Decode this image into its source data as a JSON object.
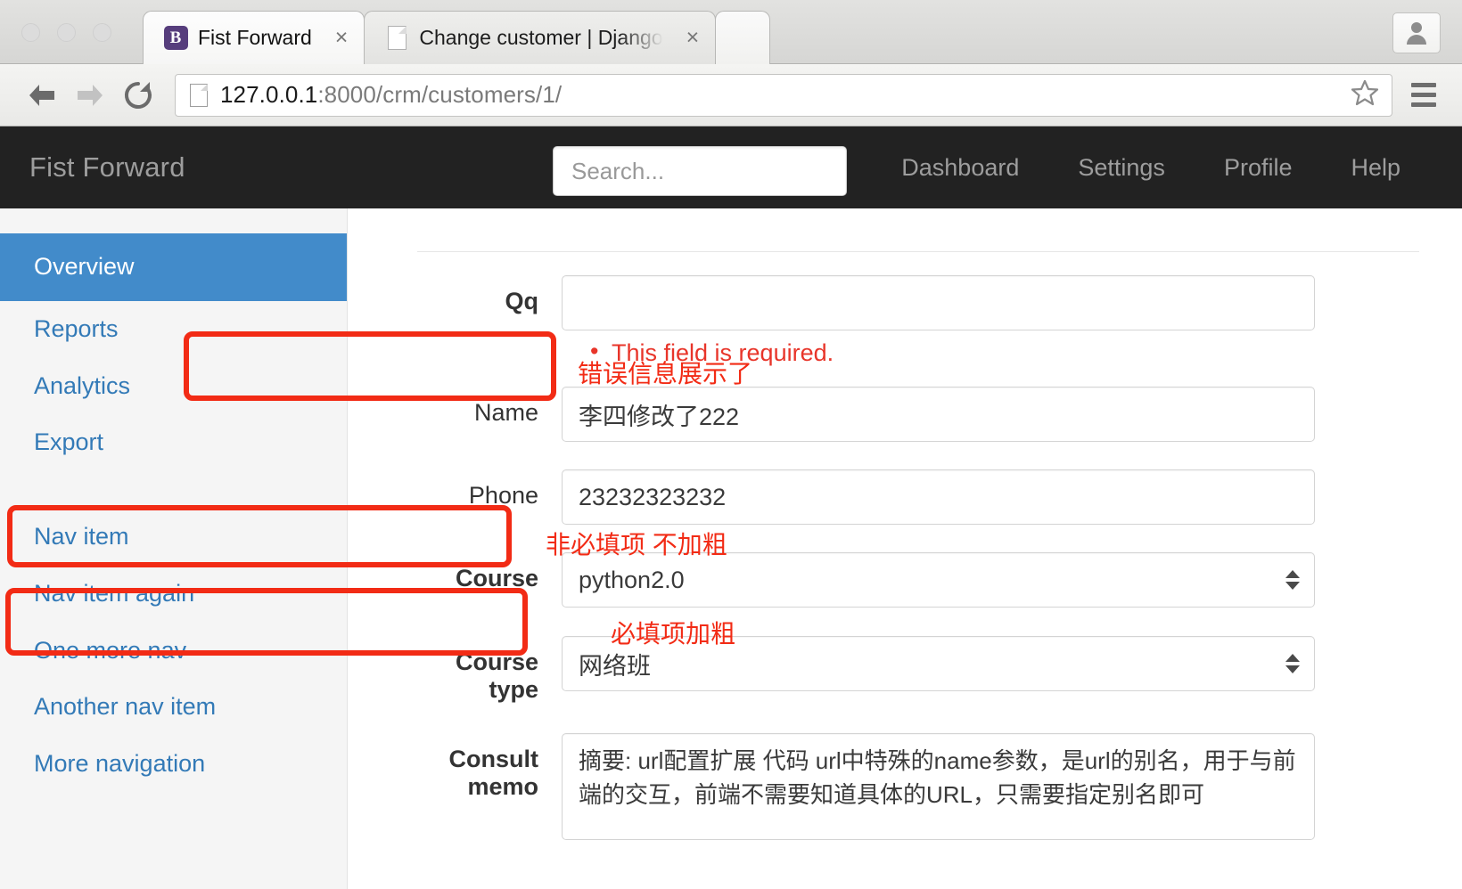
{
  "browser": {
    "tabs": [
      {
        "title": "Fist Forward",
        "favicon": "bootstrap-b-icon",
        "active": true,
        "close_label": "×"
      },
      {
        "title": "Change customer | Django",
        "favicon": "document-icon",
        "active": false,
        "close_label": "×"
      }
    ],
    "address_bar": {
      "url_host": "127.0.0.1",
      "url_rest": ":8000/crm/customers/1/"
    },
    "toolbar": {
      "back_label": "←",
      "forward_label": "→",
      "reload_label": "↻",
      "bookmark_icon": "star-icon",
      "menu_icon": "hamburger-icon",
      "profile_icon": "person-icon"
    }
  },
  "navbar": {
    "brand": "Fist Forward",
    "search_placeholder": "Search...",
    "links": [
      "Dashboard",
      "Settings",
      "Profile",
      "Help"
    ]
  },
  "sidebar": {
    "items": [
      {
        "label": "Overview",
        "active": true
      },
      {
        "label": "Reports",
        "active": false
      },
      {
        "label": "Analytics",
        "active": false
      },
      {
        "label": "Export",
        "active": false
      },
      {
        "label": "Nav item",
        "active": false
      },
      {
        "label": "Nav item again",
        "active": false
      },
      {
        "label": "One more nav",
        "active": false
      },
      {
        "label": "Another nav item",
        "active": false
      },
      {
        "label": "More navigation",
        "active": false
      }
    ]
  },
  "form": {
    "fields": [
      {
        "label": "Qq",
        "bold": true,
        "type": "text",
        "value": "",
        "errors": [
          "This field is required."
        ]
      },
      {
        "label": "Name",
        "bold": false,
        "type": "text",
        "value": "李四修改了222",
        "errors": []
      },
      {
        "label": "Phone",
        "bold": false,
        "type": "text",
        "value": "23232323232",
        "errors": []
      },
      {
        "label": "Course",
        "bold": true,
        "type": "select",
        "value": "python2.0",
        "errors": []
      },
      {
        "label": "Course type",
        "bold": true,
        "type": "select",
        "value": "网络班",
        "errors": []
      },
      {
        "label": "Consult memo",
        "bold": true,
        "type": "textarea",
        "value": "摘要: url配置扩展 代码 url中特殊的name参数，是url的别名，用于与前端的交互，前端不需要知道具体的URL，只需要指定别名即可",
        "errors": []
      }
    ]
  },
  "annotations": [
    {
      "text": "错误信息展示了"
    },
    {
      "text": "非必填项 不加粗"
    },
    {
      "text": "必填项加粗"
    }
  ],
  "colors": {
    "accent_blue": "#428bca",
    "link_blue": "#337ab7",
    "navbar_dark": "#222222",
    "error_red": "#e8352a",
    "annotation_red": "#f22b15",
    "bootstrap_purple": "#563d7c"
  }
}
